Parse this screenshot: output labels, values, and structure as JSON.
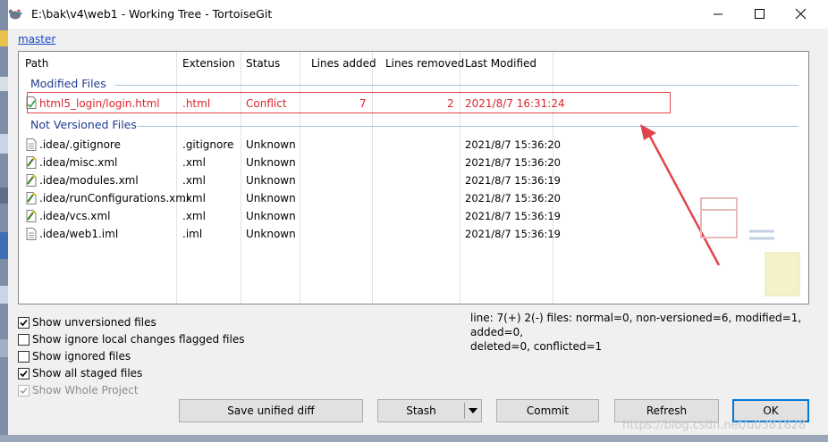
{
  "window": {
    "title": "E:\\bak\\v4\\web1 - Working Tree - TortoiseGit",
    "branch": "master"
  },
  "columns": [
    "Path",
    "Extension",
    "Status",
    "Lines added",
    "Lines removed",
    "Last Modified"
  ],
  "groups": {
    "modified": "Modified Files",
    "unversioned": "Not Versioned Files"
  },
  "modified_files": [
    {
      "path": "html5_login/login.html",
      "ext": ".html",
      "status": "Conflict",
      "added": "7",
      "removed": "2",
      "modified": "2021/8/7 16:31:24"
    }
  ],
  "unversioned_files": [
    {
      "path": ".idea/.gitignore",
      "ext": ".gitignore",
      "status": "Unknown",
      "modified": "2021/8/7 15:36:20",
      "icon": "file-icon"
    },
    {
      "path": ".idea/misc.xml",
      "ext": ".xml",
      "status": "Unknown",
      "modified": "2021/8/7 15:36:20",
      "icon": "xml-file-icon"
    },
    {
      "path": ".idea/modules.xml",
      "ext": ".xml",
      "status": "Unknown",
      "modified": "2021/8/7 15:36:19",
      "icon": "xml-file-icon"
    },
    {
      "path": ".idea/runConfigurations.xml",
      "ext": ".xml",
      "status": "Unknown",
      "modified": "2021/8/7 15:36:20",
      "icon": "xml-file-icon"
    },
    {
      "path": ".idea/vcs.xml",
      "ext": ".xml",
      "status": "Unknown",
      "modified": "2021/8/7 15:36:19",
      "icon": "xml-file-icon"
    },
    {
      "path": ".idea/web1.iml",
      "ext": ".iml",
      "status": "Unknown",
      "modified": "2021/8/7 15:36:19",
      "icon": "file-icon"
    }
  ],
  "options": [
    {
      "label": "Show unversioned files",
      "checked": true,
      "enabled": true
    },
    {
      "label": "Show ignore local changes flagged files",
      "checked": false,
      "enabled": true
    },
    {
      "label": "Show ignored files",
      "checked": false,
      "enabled": true
    },
    {
      "label": "Show all staged files",
      "checked": true,
      "enabled": true
    },
    {
      "label": "Show Whole Project",
      "checked": true,
      "enabled": false
    }
  ],
  "summary": {
    "line1": "line: 7(+) 2(-) files: normal=0, non-versioned=6, modified=1, added=0,",
    "line2": "deleted=0, conflicted=1"
  },
  "buttons": {
    "save_diff": "Save unified diff",
    "stash": "Stash",
    "commit": "Commit",
    "refresh": "Refresh",
    "ok": "OK"
  },
  "watermark": "https://blog.csdn.net/u0381828",
  "colors": {
    "conflict_text": "#e0242b",
    "group_text": "#1f3c8c",
    "link": "#1a45c4",
    "annotation_red": "#e0454a"
  }
}
